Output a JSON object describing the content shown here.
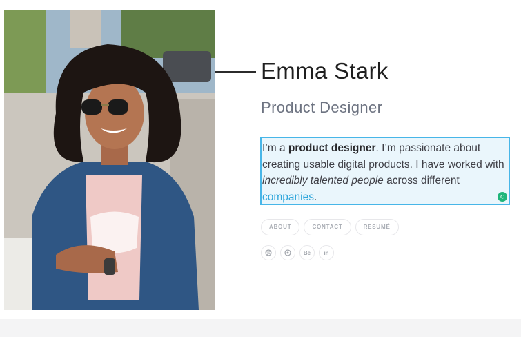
{
  "profile": {
    "name": "Emma Stark",
    "title": "Product Designer",
    "photo_alt": "Emma Stark portrait"
  },
  "bio": {
    "p1": "I’m a ",
    "strong": "product designer",
    "p2": ". I’m passionate about creating usable digital products. I have worked with ",
    "em": "incredibly talented people",
    "p3": " across different ",
    "link": "companies",
    "p4": "."
  },
  "nav": {
    "about": "ABOUT",
    "contact": "CONTACT",
    "resume": "RESUMÉ"
  },
  "social": {
    "dribbble": "dribbble-icon",
    "github": "github-icon",
    "behance": "Be",
    "linkedin": "in"
  },
  "colors": {
    "accent": "#2fa6db",
    "selection_border": "#48b6e8",
    "selection_bg": "#eaf6fc",
    "handle": "#1fb57a"
  }
}
